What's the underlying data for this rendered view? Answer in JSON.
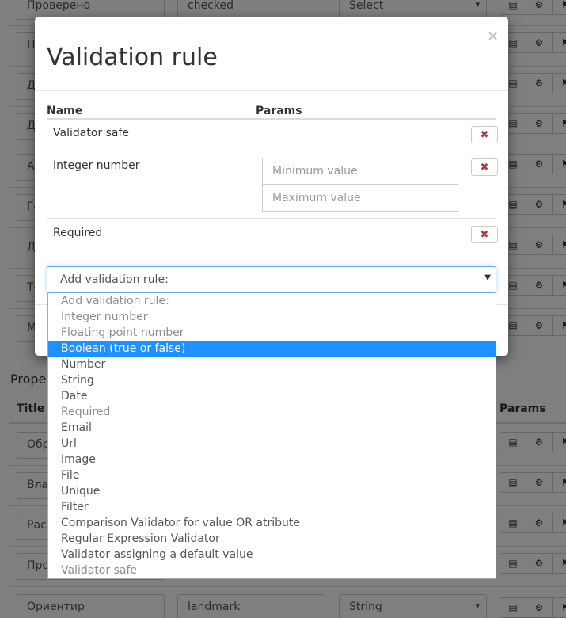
{
  "background": {
    "top_row": {
      "title": "Проверено",
      "key": "checked",
      "type": "Select"
    },
    "rows_letters": [
      "Н",
      "Д",
      "Д",
      "А",
      "Ге",
      "Д",
      "Те",
      "М"
    ],
    "section_heading": "Prope",
    "table_header": {
      "title": "Title",
      "params": "Params"
    },
    "lower_rows": [
      "Обр",
      "Вла",
      "Рас",
      "Про"
    ],
    "bottom_row": {
      "title": "Ориентир",
      "key": "landmark",
      "type": "String"
    }
  },
  "modal": {
    "title": "Validation rule",
    "close": "×",
    "header": {
      "name": "Name",
      "params": "Params"
    },
    "rules": [
      {
        "name": "Validator safe"
      },
      {
        "name": "Integer number",
        "min_placeholder": "Minimum value",
        "max_placeholder": "Maximum value"
      },
      {
        "name": "Required"
      }
    ],
    "delete_glyph": "✖",
    "select": {
      "value": "Add validation rule:",
      "options": [
        {
          "label": "Add validation rule:",
          "state": "disabled"
        },
        {
          "label": "Integer number",
          "state": "disabled"
        },
        {
          "label": "Floating point number",
          "state": "disabled"
        },
        {
          "label": "Boolean (true or false)",
          "state": "selected"
        },
        {
          "label": "Number",
          "state": "normal"
        },
        {
          "label": "String",
          "state": "normal"
        },
        {
          "label": "Date",
          "state": "normal"
        },
        {
          "label": "Required",
          "state": "disabled"
        },
        {
          "label": "Email",
          "state": "normal"
        },
        {
          "label": "Url",
          "state": "normal"
        },
        {
          "label": "Image",
          "state": "normal"
        },
        {
          "label": "File",
          "state": "normal"
        },
        {
          "label": "Unique",
          "state": "normal"
        },
        {
          "label": "Filter",
          "state": "normal"
        },
        {
          "label": "Comparison Validator for value OR atribute",
          "state": "normal"
        },
        {
          "label": "Regular Expression Validator",
          "state": "normal"
        },
        {
          "label": "Validator assigning a default value",
          "state": "normal"
        },
        {
          "label": "Validator safe",
          "state": "disabled"
        }
      ]
    }
  },
  "icons": {
    "list": "list-icon",
    "gear": "gear-icon",
    "flag": "flag-icon",
    "delete": "close-icon",
    "caret": "caret-down-icon"
  },
  "colors": {
    "selected_option": "#1e90ff",
    "delete_icon": "#b13b3b",
    "focus_border": "#66afe9"
  }
}
